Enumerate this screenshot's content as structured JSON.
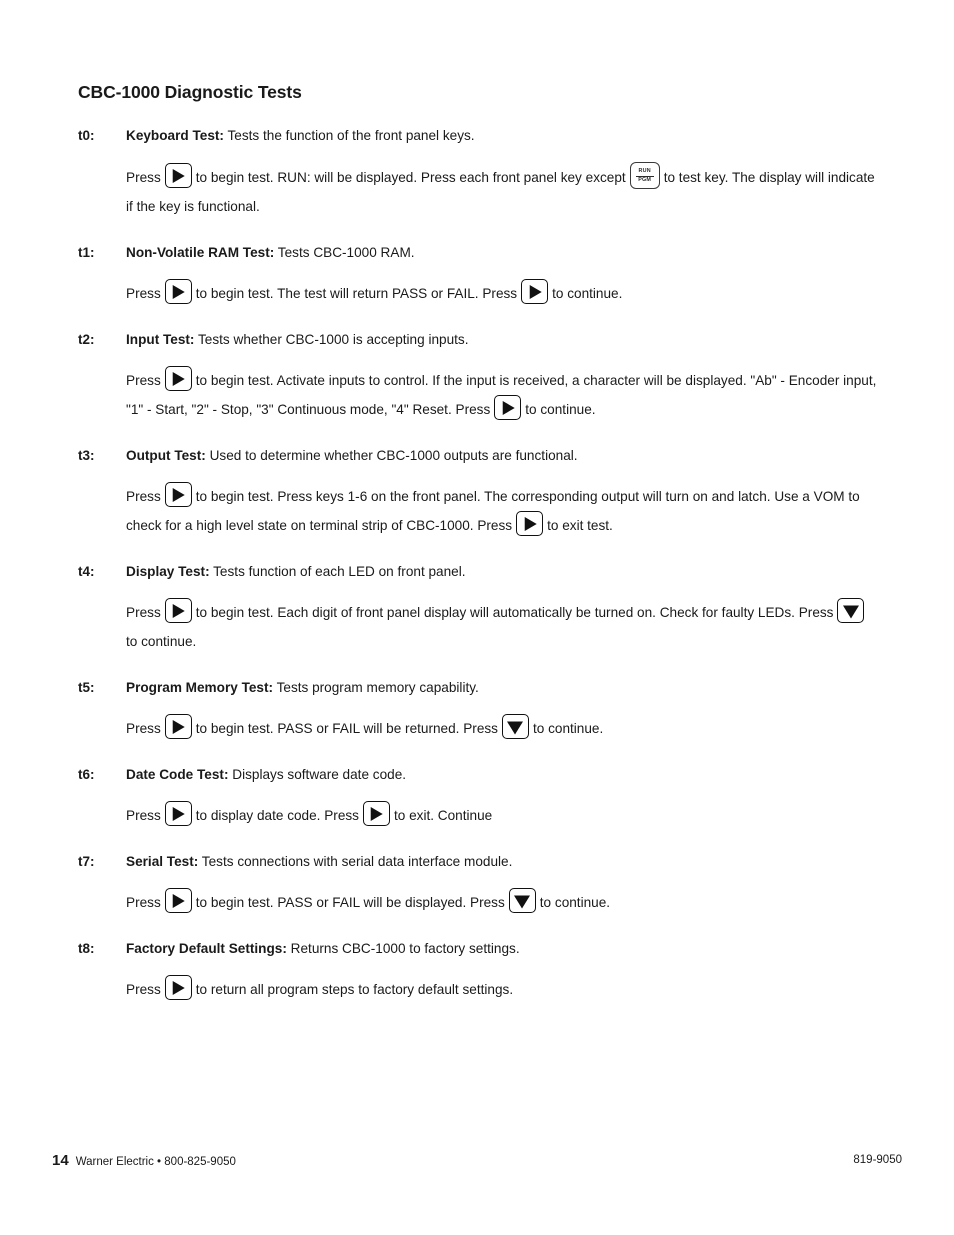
{
  "document": {
    "title": "CBC-1000 Diagnostic Tests"
  },
  "keys": {
    "play": {
      "name": "play-key",
      "glyph": "▶"
    },
    "down": {
      "name": "down-arrow-key",
      "glyph": "▼"
    },
    "runpgm": {
      "name": "run-pgm-key",
      "line1": "RUN",
      "line2": "PGM"
    }
  },
  "tests": [
    {
      "id": "t0:",
      "name": "Keyboard Test:",
      "desc": " Tests the function of the front panel keys.",
      "step_parts": [
        "Press",
        "to begin test. RUN: will be displayed. Press each front panel key except",
        "to test key. The display will indicate if the key is functional."
      ]
    },
    {
      "id": "t1:",
      "name": "Non-Volatile RAM Test:",
      "desc": " Tests CBC-1000 RAM.",
      "step_parts": [
        "Press",
        "to begin test. The test will return PASS or FAIL. Press",
        "to continue."
      ]
    },
    {
      "id": "t2:",
      "name": "Input Test:",
      "desc": " Tests whether CBC-1000 is accepting inputs.",
      "step_parts": [
        "Press",
        "to begin test. Activate inputs to control. If the input is received, a character will be displayed. \"Ab\" - Encoder input,  \"1\" - Start, \"2\" - Stop, \"3\" Continuous mode, \"4\" Reset. Press",
        "to continue."
      ]
    },
    {
      "id": "t3:",
      "name": "Output Test:",
      "desc": " Used to determine whether CBC-1000 outputs are functional.",
      "step_parts": [
        "Press",
        "to begin test. Press keys 1-6 on the front panel. The corresponding output will turn on and latch. Use a VOM to check for a high level state on terminal strip of CBC-1000. Press",
        "to exit test."
      ]
    },
    {
      "id": "t4:",
      "name": "Display Test:",
      "desc": " Tests function of each LED on front panel.",
      "step_parts": [
        "Press",
        "to begin test. Each digit of front panel display will automatically be turned on. Check for faulty LEDs. Press",
        "to continue."
      ]
    },
    {
      "id": "t5:",
      "name": "Program Memory Test:",
      "desc": " Tests program memory capability.",
      "step_parts": [
        "Press",
        "to begin test. PASS or FAIL will be returned. Press",
        "to continue."
      ]
    },
    {
      "id": "t6:",
      "name": "Date Code Test:",
      "desc": " Displays software date code.",
      "step_parts": [
        "Press",
        "to display date code. Press",
        "to exit. Continue"
      ]
    },
    {
      "id": "t7:",
      "name": "Serial Test:",
      "desc": " Tests connections with serial data interface module.",
      "step_parts": [
        "Press",
        "to begin test. PASS or FAIL will be displayed. Press",
        "to continue."
      ]
    },
    {
      "id": "t8:",
      "name": "Factory Default Settings:",
      "desc": " Returns CBC-1000 to factory settings.",
      "step_parts": [
        "Press",
        "to return all program steps to factory default settings."
      ]
    }
  ],
  "footer": {
    "page_number": "14",
    "imprint": "Warner Electric • 800-825-9050",
    "doc_number": "819-9050"
  }
}
